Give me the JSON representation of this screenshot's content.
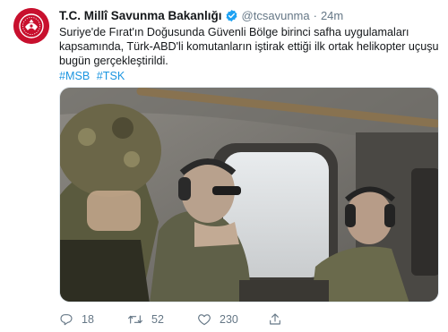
{
  "tweet": {
    "author_name": "T.C. Millî Savunma Bakanlığı",
    "handle": "@tcsavunma",
    "separator": "·",
    "time": "24m",
    "text_lines": [
      "Suriye'de Fırat'ın Doğusunda Güvenli Bölge birinci safha uygulamaları",
      "kapsamında, Türk-ABD'li komutanların iştirak ettiği ilk ortak helikopter uçuşu",
      "bugün gerçekleştirildi."
    ],
    "hashtags": [
      "#MSB",
      "#TSK"
    ],
    "replies": "18",
    "retweets": "52",
    "likes": "230"
  },
  "icons": {
    "avatar": "ministry-emblem-icon",
    "verified": "verified-badge-icon",
    "reply": "reply-icon",
    "retweet": "retweet-icon",
    "like": "heart-icon",
    "share": "share-icon"
  },
  "colors": {
    "link": "#1b95e0",
    "muted": "#657786",
    "avatar_red": "#c8102e",
    "verified": "#1da1f2"
  }
}
